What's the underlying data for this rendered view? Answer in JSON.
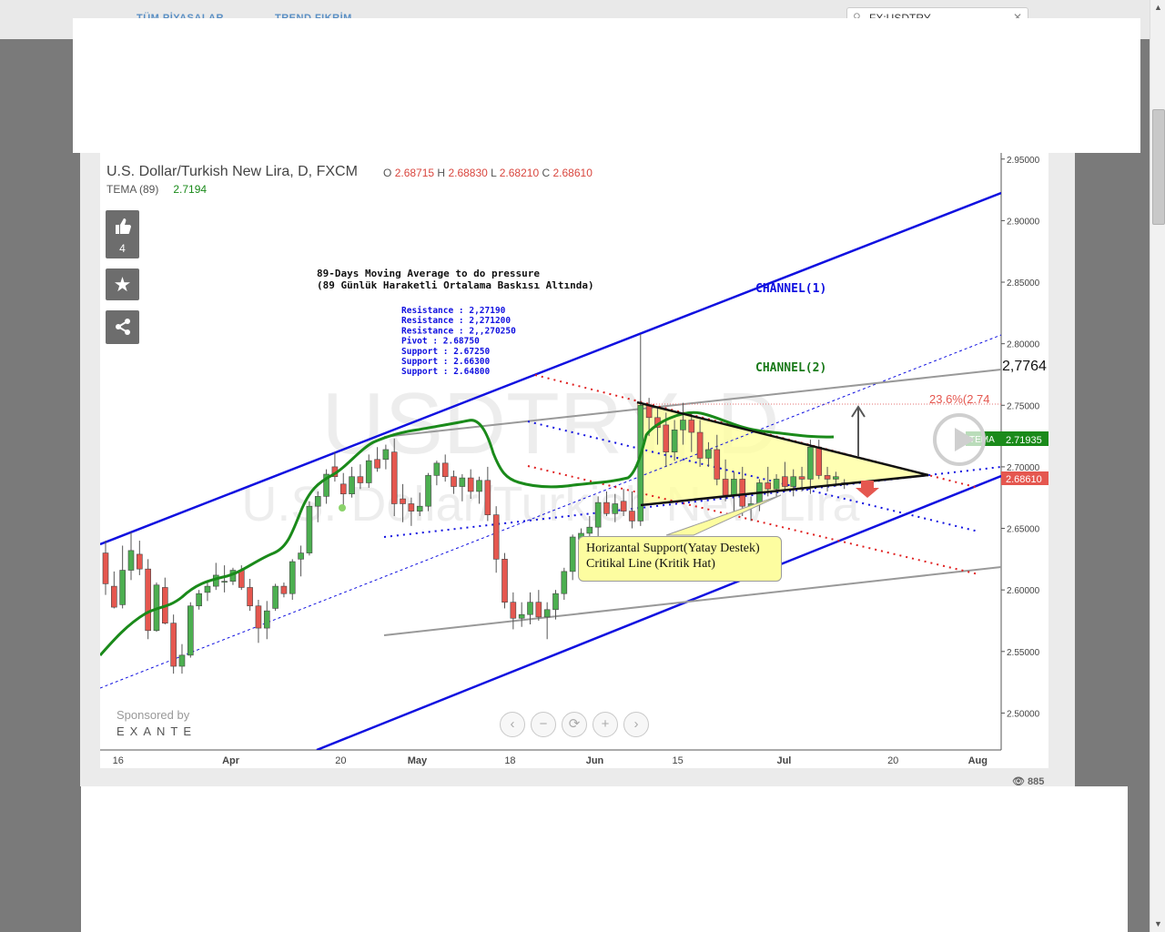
{
  "topnav": {
    "item1": "TÜM PİYASALAR",
    "item2": "TREND FIKRİM"
  },
  "search": {
    "value": "FX:USDTRY"
  },
  "chart_header": {
    "title": "U.S. Dollar/Turkish New Lira, D, FXCM",
    "o_label": "O",
    "o_value": "2.68715",
    "h_label": "H",
    "h_value": "2.68830",
    "l_label": "L",
    "l_value": "2.68210",
    "c_label": "C",
    "c_value": "2.68610",
    "indicator_label": "TEMA (89)",
    "indicator_value": "2.7194"
  },
  "side": {
    "likes": "4"
  },
  "watermark": {
    "big": "USDTRY, D",
    "small": "U.S. Dollar/Turkish New Lira"
  },
  "annotations": {
    "title_line1": "89-Days Moving Average to do pressure",
    "title_line2": "(89 Günlük  Haraketli Ortalama Baskısı Altında)",
    "levels": [
      "Resistance : 2,27190",
      "Resistance  : 2,271200",
      "Resistance  : 2,,270250",
      "Pivot  : 2.68750",
      "Support   : 2.67250",
      "Support   : 2.66300",
      "Support   : 2.64800"
    ],
    "channel1": "CHANNEL(1)",
    "channel2": "CHANNEL(2)",
    "fib": "23.6%(2.74",
    "callout_line1": "Horizantal Support(Yatay Destek)",
    "callout_line2": "Critikal Line (Kritik Hat)",
    "level_2_7764": "2,7764"
  },
  "price_labels": {
    "tema_tag": "TEMA",
    "tema_price": "2.71935",
    "last_price": "2.68610"
  },
  "sponsor": {
    "by": "Sponsored by",
    "brand": "EXANTE"
  },
  "views": {
    "count": "885"
  },
  "colors": {
    "up": "#4caf50",
    "down": "#e5574f",
    "channel": "#1010e0",
    "tema": "#1a8a1a"
  },
  "chart_data": {
    "type": "candlestick",
    "symbol": "USDTRY",
    "yticks": [
      "2.50000",
      "2.55000",
      "2.60000",
      "2.65000",
      "2.70000",
      "2.75000",
      "2.80000",
      "2.85000",
      "2.90000",
      "2.95000"
    ],
    "ylim": [
      2.47,
      2.955
    ],
    "xticks": [
      {
        "label": "16",
        "x": 0.02
      },
      {
        "label": "Apr",
        "x": 0.145
      },
      {
        "label": "20",
        "x": 0.267
      },
      {
        "label": "May",
        "x": 0.352
      },
      {
        "label": "18",
        "x": 0.455
      },
      {
        "label": "Jun",
        "x": 0.549
      },
      {
        "label": "15",
        "x": 0.641
      },
      {
        "label": "Jul",
        "x": 0.759
      },
      {
        "label": "20",
        "x": 0.88
      },
      {
        "label": "Aug",
        "x": 0.974
      }
    ],
    "candles": [
      [
        2.63,
        2.64,
        2.596,
        2.605
      ],
      [
        2.603,
        2.615,
        2.585,
        2.586
      ],
      [
        2.588,
        2.636,
        2.585,
        2.616
      ],
      [
        2.616,
        2.647,
        2.608,
        2.632
      ],
      [
        2.629,
        2.64,
        2.612,
        2.617
      ],
      [
        2.617,
        2.625,
        2.56,
        2.567
      ],
      [
        2.567,
        2.606,
        2.566,
        2.604
      ],
      [
        2.602,
        2.61,
        2.572,
        2.573
      ],
      [
        2.573,
        2.58,
        2.532,
        2.538
      ],
      [
        2.538,
        2.556,
        2.532,
        2.547
      ],
      [
        2.547,
        2.59,
        2.545,
        2.587
      ],
      [
        2.587,
        2.6,
        2.584,
        2.597
      ],
      [
        2.598,
        2.607,
        2.591,
        2.603
      ],
      [
        2.603,
        2.622,
        2.6,
        2.612
      ],
      [
        2.607,
        2.62,
        2.598,
        2.607
      ],
      [
        2.607,
        2.618,
        2.604,
        2.616
      ],
      [
        2.616,
        2.62,
        2.6,
        2.602
      ],
      [
        2.602,
        2.609,
        2.583,
        2.587
      ],
      [
        2.587,
        2.592,
        2.557,
        2.569
      ],
      [
        2.569,
        2.591,
        2.56,
        2.583
      ],
      [
        2.585,
        2.605,
        2.583,
        2.603
      ],
      [
        2.603,
        2.606,
        2.594,
        2.597
      ],
      [
        2.597,
        2.625,
        2.592,
        2.623
      ],
      [
        2.625,
        2.636,
        2.611,
        2.63
      ],
      [
        2.63,
        2.672,
        2.628,
        2.668
      ],
      [
        2.668,
        2.68,
        2.655,
        2.676
      ],
      [
        2.676,
        2.698,
        2.67,
        2.694
      ],
      [
        2.7,
        2.712,
        2.688,
        2.692
      ],
      [
        2.686,
        2.695,
        2.668,
        2.678
      ],
      [
        2.678,
        2.7,
        2.675,
        2.692
      ],
      [
        2.692,
        2.702,
        2.682,
        2.687
      ],
      [
        2.687,
        2.71,
        2.683,
        2.705
      ],
      [
        2.706,
        2.716,
        2.696,
        2.699
      ],
      [
        2.706,
        2.718,
        2.698,
        2.714
      ],
      [
        2.712,
        2.723,
        2.66,
        2.67
      ],
      [
        2.674,
        2.686,
        2.655,
        2.67
      ],
      [
        2.67,
        2.675,
        2.652,
        2.664
      ],
      [
        2.664,
        2.679,
        2.66,
        2.668
      ],
      [
        2.668,
        2.695,
        2.664,
        2.693
      ],
      [
        2.693,
        2.705,
        2.685,
        2.703
      ],
      [
        2.703,
        2.71,
        2.688,
        2.692
      ],
      [
        2.692,
        2.697,
        2.678,
        2.684
      ],
      [
        2.684,
        2.694,
        2.672,
        2.691
      ],
      [
        2.691,
        2.698,
        2.674,
        2.68
      ],
      [
        2.68,
        2.692,
        2.67,
        2.689
      ],
      [
        2.689,
        2.7,
        2.656,
        2.661
      ],
      [
        2.661,
        2.668,
        2.614,
        2.625
      ],
      [
        2.625,
        2.63,
        2.585,
        2.59
      ],
      [
        2.59,
        2.598,
        2.568,
        2.577
      ],
      [
        2.577,
        2.59,
        2.57,
        2.58
      ],
      [
        2.58,
        2.598,
        2.572,
        2.59
      ],
      [
        2.59,
        2.6,
        2.575,
        2.578
      ],
      [
        2.578,
        2.59,
        2.56,
        2.584
      ],
      [
        2.584,
        2.6,
        2.576,
        2.597
      ],
      [
        2.597,
        2.618,
        2.592,
        2.615
      ],
      [
        2.615,
        2.645,
        2.608,
        2.643
      ],
      [
        2.641,
        2.65,
        2.628,
        2.646
      ],
      [
        2.646,
        2.66,
        2.64,
        2.651
      ],
      [
        2.651,
        2.676,
        2.642,
        2.671
      ],
      [
        2.671,
        2.68,
        2.66,
        2.662
      ],
      [
        2.662,
        2.678,
        2.655,
        2.67
      ],
      [
        2.672,
        2.682,
        2.66,
        2.664
      ],
      [
        2.664,
        2.68,
        2.65,
        2.656
      ],
      [
        2.656,
        2.808,
        2.652,
        2.75
      ],
      [
        2.75,
        2.756,
        2.725,
        2.74
      ],
      [
        2.74,
        2.748,
        2.718,
        2.732
      ],
      [
        2.734,
        2.744,
        2.7,
        2.712
      ],
      [
        2.712,
        2.738,
        2.705,
        2.73
      ],
      [
        2.73,
        2.752,
        2.718,
        2.738
      ],
      [
        2.738,
        2.744,
        2.712,
        2.728
      ],
      [
        2.728,
        2.738,
        2.7,
        2.707
      ],
      [
        2.707,
        2.72,
        2.7,
        2.714
      ],
      [
        2.714,
        2.726,
        2.685,
        2.69
      ],
      [
        2.69,
        2.706,
        2.672,
        2.677
      ],
      [
        2.677,
        2.696,
        2.662,
        2.69
      ],
      [
        2.69,
        2.7,
        2.66,
        2.668
      ],
      [
        2.668,
        2.676,
        2.656,
        2.67
      ],
      [
        2.67,
        2.69,
        2.664,
        2.687
      ],
      [
        2.687,
        2.7,
        2.676,
        2.682
      ],
      [
        2.682,
        2.694,
        2.676,
        2.69
      ],
      [
        2.692,
        2.704,
        2.68,
        2.684
      ],
      [
        2.684,
        2.698,
        2.676,
        2.692
      ],
      [
        2.692,
        2.7,
        2.68,
        2.69
      ],
      [
        2.69,
        2.722,
        2.678,
        2.716
      ],
      [
        2.716,
        2.722,
        2.69,
        2.693
      ],
      [
        2.693,
        2.7,
        2.68,
        2.69
      ],
      [
        2.69,
        2.696,
        2.684,
        2.692
      ],
      [
        2.687,
        2.69,
        2.682,
        2.686
      ]
    ]
  }
}
